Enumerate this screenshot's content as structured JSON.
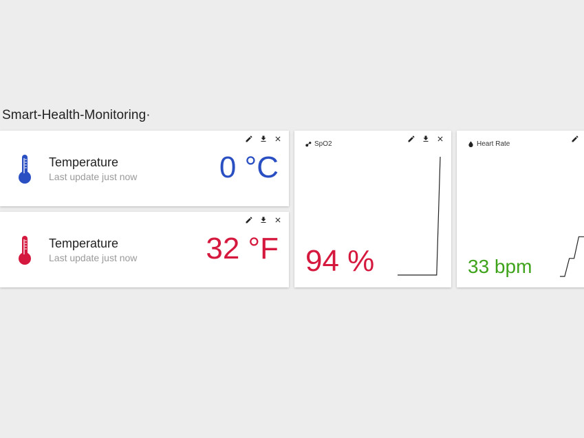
{
  "dashboard": {
    "title": "Smart-Health-Monitoring·"
  },
  "colors": {
    "blue": "#2a4fc2",
    "red": "#d5193e",
    "green": "#3ea31b"
  },
  "temperature_c": {
    "label": "Temperature",
    "subtitle": "Last update just now",
    "value": "0 °C",
    "icon": "thermometer-icon"
  },
  "temperature_f": {
    "label": "Temperature",
    "subtitle": "Last update just now",
    "value": "32 °F",
    "icon": "thermometer-icon"
  },
  "spo2": {
    "title": "SpO2",
    "icon": "molecule-icon",
    "value": "94 %",
    "sparkline": [
      0,
      0,
      0,
      0,
      0,
      0,
      0,
      0,
      0,
      0,
      0,
      0,
      94
    ]
  },
  "heart_rate": {
    "title": "Heart Rate",
    "icon": "drop-icon",
    "value": "33 bpm",
    "sparkline": [
      0,
      0,
      15,
      15,
      33,
      33,
      33,
      33
    ]
  },
  "actions": {
    "edit": "pencil-icon",
    "download": "download-icon",
    "close": "close-icon"
  }
}
